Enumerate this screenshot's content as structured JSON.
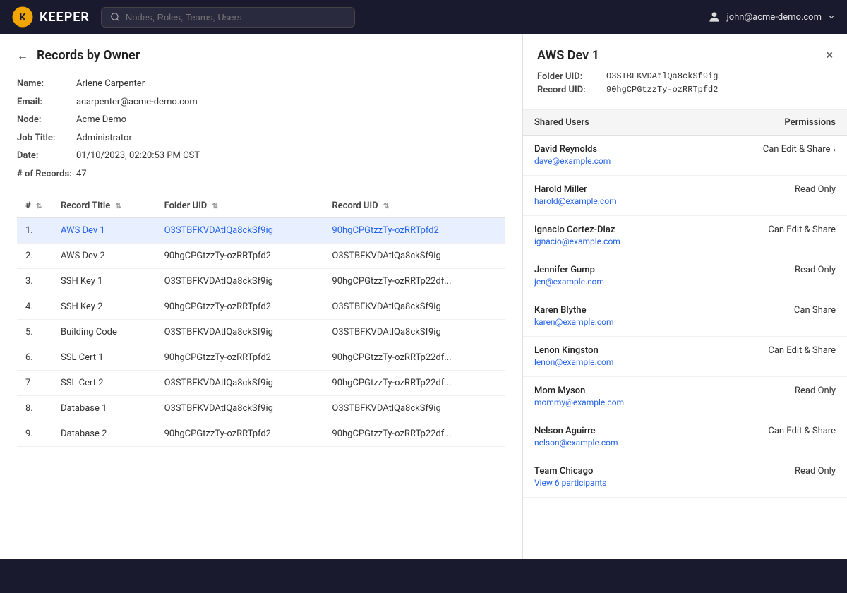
{
  "nav": {
    "logo_text": "KEEPER",
    "search_placeholder": "Nodes, Roles, Teams, Users",
    "user_email": "john@acme-demo.com"
  },
  "page": {
    "title": "Records by Owner",
    "back_label": "←"
  },
  "owner": {
    "name_label": "Name:",
    "name_value": "Arlene Carpenter",
    "email_label": "Email:",
    "email_value": "acarpenter@acme-demo.com",
    "node_label": "Node:",
    "node_value": "Acme Demo",
    "job_title_label": "Job Title:",
    "job_title_value": "Administrator",
    "date_label": "Date:",
    "date_value": "01/10/2023, 02:20:53 PM CST",
    "records_label": "# of Records:",
    "records_value": "47"
  },
  "table": {
    "columns": [
      {
        "id": "num",
        "label": "#",
        "sortable": true
      },
      {
        "id": "record_title",
        "label": "Record Title",
        "sortable": true
      },
      {
        "id": "folder_uid",
        "label": "Folder UID",
        "sortable": true
      },
      {
        "id": "record_uid",
        "label": "Record UID",
        "sortable": true
      }
    ],
    "rows": [
      {
        "num": "1.",
        "record_title": "AWS Dev 1",
        "folder_uid": "O3STBFKVDAtlQa8ckSf9ig",
        "record_uid": "90hgCPGtzzTy-ozRRTpfd2",
        "is_link": true,
        "selected": true
      },
      {
        "num": "2.",
        "record_title": "AWS Dev 2",
        "folder_uid": "90hgCPGtzzTy-ozRRTpfd2",
        "record_uid": "O3STBFKVDAtlQa8ckSf9ig",
        "is_link": false,
        "selected": false
      },
      {
        "num": "3.",
        "record_title": "SSH Key 1",
        "folder_uid": "O3STBFKVDAtlQa8ckSf9ig",
        "record_uid": "90hgCPGtzzTy-ozRRTp22df...",
        "is_link": false,
        "selected": false
      },
      {
        "num": "4.",
        "record_title": "SSH Key 2",
        "folder_uid": "90hgCPGtzzTy-ozRRTpfd2",
        "record_uid": "O3STBFKVDAtlQa8ckSf9ig",
        "is_link": false,
        "selected": false
      },
      {
        "num": "5.",
        "record_title": "Building Code",
        "folder_uid": "O3STBFKVDAtlQa8ckSf9ig",
        "record_uid": "O3STBFKVDAtlQa8ckSf9ig",
        "is_link": false,
        "selected": false
      },
      {
        "num": "6.",
        "record_title": "SSL Cert 1",
        "folder_uid": "90hgCPGtzzTy-ozRRTpfd2",
        "record_uid": "90hgCPGtzzTy-ozRRTp22df...",
        "is_link": false,
        "selected": false
      },
      {
        "num": "7",
        "record_title": "SSL Cert 2",
        "folder_uid": "O3STBFKVDAtlQa8ckSf9ig",
        "record_uid": "90hgCPGtzzTy-ozRRTp22df...",
        "is_link": false,
        "selected": false
      },
      {
        "num": "8.",
        "record_title": "Database 1",
        "folder_uid": "O3STBFKVDAtlQa8ckSf9ig",
        "record_uid": "O3STBFKVDAtlQa8ckSf9ig",
        "is_link": false,
        "selected": false
      },
      {
        "num": "9.",
        "record_title": "Database 2",
        "folder_uid": "90hgCPGtzzTy-ozRRTpfd2",
        "record_uid": "90hgCPGtzzTy-ozRRTp22df...",
        "is_link": false,
        "selected": false
      }
    ]
  },
  "detail_panel": {
    "title": "AWS Dev 1",
    "close_btn": "×",
    "folder_uid_label": "Folder UID:",
    "folder_uid_value": "O3STBFKVDAtlQa8ckSf9ig",
    "record_uid_label": "Record UID:",
    "record_uid_value": "90hgCPGtzzTy-ozRRTpfd2",
    "shared_users_col": "Shared Users",
    "permissions_col": "Permissions",
    "shared_users": [
      {
        "name": "David Reynolds",
        "email": "dave@example.com",
        "permission": "Can Edit & Share",
        "has_arrow": true
      },
      {
        "name": "Harold Miller",
        "email": "harold@example.com",
        "permission": "Read Only",
        "has_arrow": false
      },
      {
        "name": "Ignacio Cortez-Diaz",
        "email": "ignacio@example.com",
        "permission": "Can Edit & Share",
        "has_arrow": false
      },
      {
        "name": "Jennifer Gump",
        "email": "jen@example.com",
        "permission": "Read Only",
        "has_arrow": false
      },
      {
        "name": "Karen Blythe",
        "email": "karen@example.com",
        "permission": "Can Share",
        "has_arrow": false
      },
      {
        "name": "Lenon Kingston",
        "email": "lenon@example.com",
        "permission": "Can Edit & Share",
        "has_arrow": false
      },
      {
        "name": "Mom Myson",
        "email": "mommy@example.com",
        "permission": "Read Only",
        "has_arrow": false
      },
      {
        "name": "Nelson Aguirre",
        "email": "nelson@example.com",
        "permission": "Can Edit & Share",
        "has_arrow": false
      },
      {
        "name": "Team Chicago",
        "email": "View 6 participants",
        "permission": "Read Only",
        "has_arrow": false,
        "is_team": true
      }
    ]
  }
}
